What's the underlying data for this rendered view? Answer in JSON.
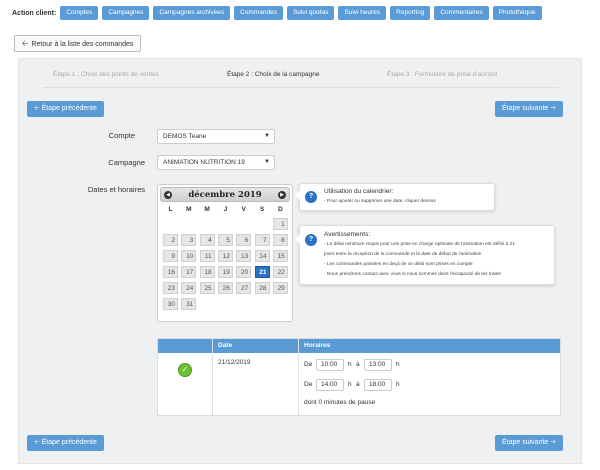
{
  "nav": {
    "label": "Action client:",
    "items": [
      "Comptes",
      "Campagnes",
      "Campagnes archivées",
      "Commandes",
      "Suivi quotas",
      "Suivi heures",
      "Reporting",
      "Commentaires",
      "Photothèque"
    ]
  },
  "back_button": "Retour à la liste des commandes",
  "steps": [
    "Étape 1 : Choix des points de ventes",
    "Étape 2 : Choix de la campagne",
    "Étape 3 : Formulaire de prise d'accord"
  ],
  "buttons": {
    "prev": "Étape précédente",
    "next": "Étape suivante"
  },
  "form": {
    "compte_label": "Compte",
    "compte_value": "DEMOS Teane",
    "campagne_label": "Campagne",
    "campagne_value": "ANIMATION NUTRITION 19",
    "dates_label": "Dates et horaires"
  },
  "calendar": {
    "title": "décembre 2019",
    "weekdays": [
      "L",
      "M",
      "M",
      "J",
      "V",
      "S",
      "D"
    ],
    "days": [
      "1",
      "2",
      "3",
      "4",
      "5",
      "6",
      "7",
      "8",
      "9",
      "10",
      "11",
      "12",
      "13",
      "14",
      "15",
      "16",
      "17",
      "18",
      "19",
      "20",
      "21",
      "22",
      "23",
      "24",
      "25",
      "26",
      "27",
      "28",
      "29",
      "30",
      "31"
    ],
    "selected": "21"
  },
  "info1": {
    "title": "Utilisation du calendrier:",
    "lines": [
      "- Pour ajouter ou supprimer une date, cliquer dessus"
    ]
  },
  "info2": {
    "title": "Avertissements:",
    "lines": [
      "- Le délai minimum requis pour une prise en charge optimale de l'animation est défini à 21",
      "jours entre la réception de la commande et la date de début de l'animation",
      "- Les commandes passées en deçà de ce délai sont prises en compte",
      "- Nous prendrons contact avec vous si nous sommes dans l'incapacité de les traiter"
    ]
  },
  "table": {
    "headers": [
      "",
      "Date",
      "Horaires"
    ],
    "row": {
      "date": "21/12/2019",
      "de": "De",
      "a": "à",
      "h": "h",
      "slots": [
        {
          "start": "10:00",
          "end": "13:00"
        },
        {
          "start": "14:00",
          "end": "18:00"
        }
      ],
      "pause": "dont 0 minutes de pause"
    }
  },
  "colors": {
    "primary": "#5b9bd5",
    "selected_day": "#2a72c4",
    "check": "#6cc033"
  }
}
